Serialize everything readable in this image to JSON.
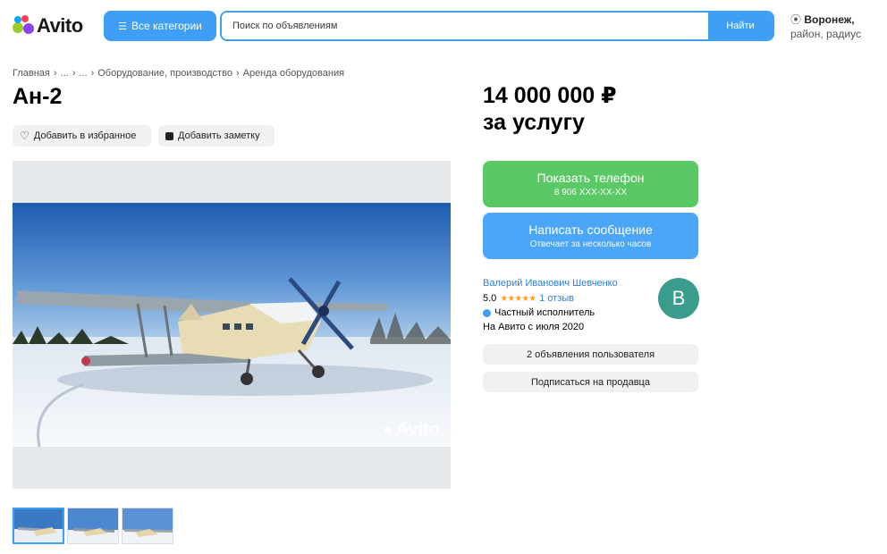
{
  "header": {
    "logo_text": "Avito",
    "categories_label": "Все категории",
    "search": {
      "placeholder": "Поиск по объявлениям",
      "button_label": "Найти"
    },
    "location": {
      "city": "Воронеж,",
      "detail": "район, радиус"
    }
  },
  "breadcrumb": [
    "Главная",
    "...",
    "...",
    "Оборудование, производство",
    "Аренда оборудования"
  ],
  "breadcrumb_separator": "›",
  "listing": {
    "title": "Ан-2",
    "favorite_label": "Добавить в избранное",
    "note_label": "Добавить заметку",
    "price": "14 000 000 ₽",
    "price_unit": "за услугу",
    "watermark": "Avito"
  },
  "contact": {
    "phone_label": "Показать телефон",
    "phone_masked": "8 906 XXX-XX-XX",
    "message_label": "Написать сообщение",
    "message_sub": "Отвечает за несколько часов"
  },
  "seller": {
    "name": "Валерий Иванович Шевченко",
    "rating": "5.0",
    "stars": "★★★★★",
    "reviews": "1 отзыв",
    "type": "Частный исполнитель",
    "since": "На Авито с июля 2020",
    "avatar_letter": "В",
    "ads_label": "2 объявления пользователя",
    "subscribe_label": "Подписаться на продавца"
  },
  "colors": {
    "accent_blue": "#3f9ff5",
    "phone_green": "#5bc866",
    "message_blue": "#4ca6f7",
    "avatar_teal": "#3a9c8c"
  },
  "icons": [
    "avito-logo-dots",
    "categories-icon",
    "location-pin-icon",
    "heart-icon",
    "note-icon",
    "star-icon",
    "verified-icon"
  ]
}
